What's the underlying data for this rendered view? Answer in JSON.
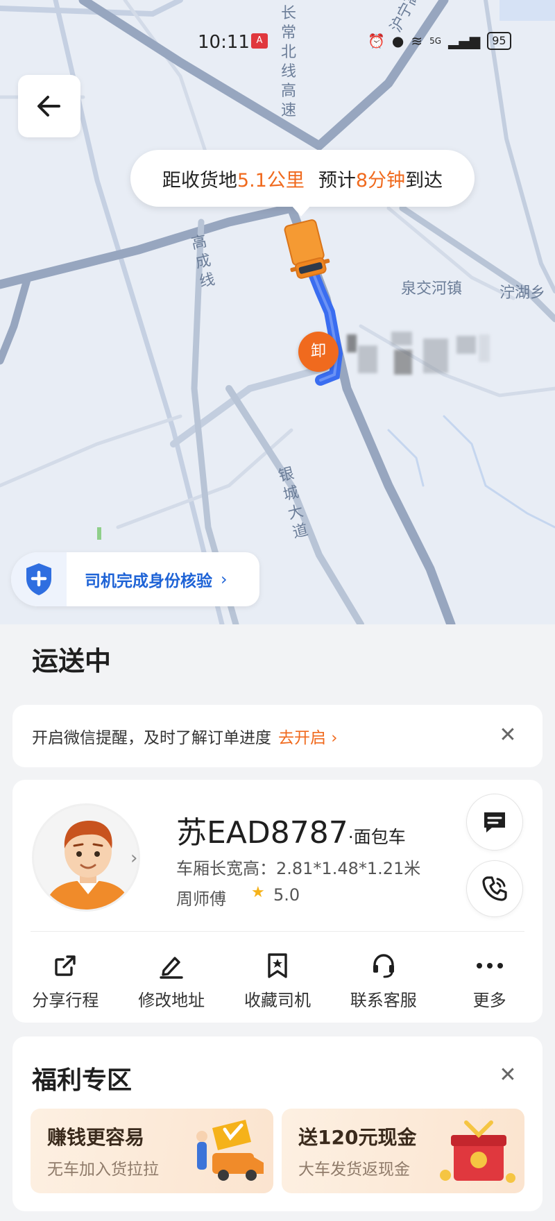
{
  "status_bar": {
    "time": "10:11",
    "alert_icon": "A",
    "signal": "5G",
    "battery": "95"
  },
  "map": {
    "labels": {
      "changchang": "长常北线高速",
      "huning": "沪宁高速",
      "gaocheng": "高成线",
      "quanjiaohe": "泉交河镇",
      "ninghu": "泞湖乡",
      "yincheng": "银城大道"
    },
    "eta": {
      "prefix": "距收货地",
      "distance": "5.1公里",
      "mid": "预计",
      "minutes": "8分钟",
      "suffix": "到达"
    },
    "unload_marker": "卸",
    "verify_text": "司机完成身份核验"
  },
  "panel": {
    "status_title": "运送中",
    "notice_text": "开启微信提醒，及时了解订单进度",
    "notice_link": "去开启",
    "driver": {
      "plate": "苏EAD8787",
      "vehicle_type": "·面包车",
      "dimensions": "车厢长宽高：2.81*1.48*1.21米",
      "name": "周师傅",
      "rating": "5.0"
    },
    "actions": [
      {
        "label": "分享行程",
        "icon": "share-icon"
      },
      {
        "label": "修改地址",
        "icon": "edit-icon"
      },
      {
        "label": "收藏司机",
        "icon": "favorite-icon"
      },
      {
        "label": "联系客服",
        "icon": "headset-icon"
      },
      {
        "label": "更多",
        "icon": "more-icon"
      }
    ],
    "benefits": {
      "title": "福利专区",
      "promos": [
        {
          "title": "赚钱更容易",
          "subtitle": "无车加入货拉拉"
        },
        {
          "title": "送120元现金",
          "subtitle": "大车发货返现金"
        }
      ]
    }
  },
  "colors": {
    "accent": "#f06a1e",
    "link_blue": "#1e63d6",
    "route_blue": "#3a6df0",
    "page_bg": "#f2f3f5"
  }
}
